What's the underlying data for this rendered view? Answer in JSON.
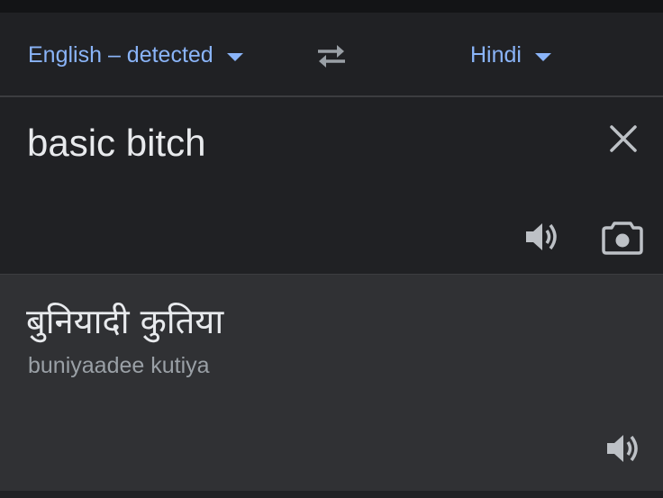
{
  "language_bar": {
    "source_language": "English – detected",
    "target_language": "Hindi",
    "swap_icon": "swap-arrows-icon",
    "dropdown_icon": "caret-down-icon",
    "accent_color": "#8ab4f8"
  },
  "input_panel": {
    "text": "basic bitch",
    "clear_icon": "close-icon",
    "speak_icon": "speaker-icon",
    "camera_icon": "camera-icon"
  },
  "output_panel": {
    "translation": "बुनियादी कुतिया",
    "transliteration": "buniyaadee kutiya",
    "speak_icon": "speaker-icon"
  }
}
